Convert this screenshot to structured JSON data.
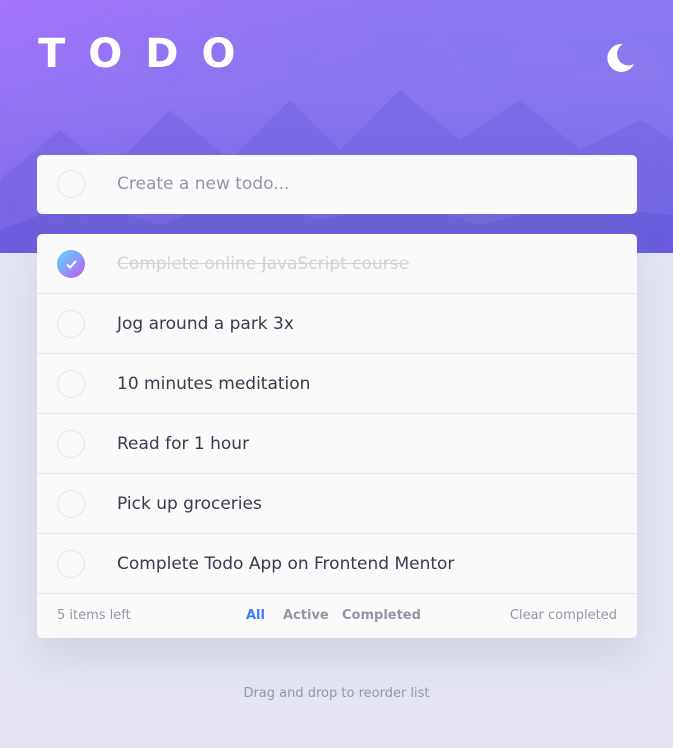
{
  "app": {
    "title": "TODO",
    "theme_toggle_icon": "moon-icon"
  },
  "new_todo": {
    "placeholder": "Create a new todo..."
  },
  "todos": [
    {
      "text": "Complete online JavaScript course",
      "completed": true
    },
    {
      "text": "Jog around a park 3x",
      "completed": false
    },
    {
      "text": "10 minutes meditation",
      "completed": false
    },
    {
      "text": "Read for 1 hour",
      "completed": false
    },
    {
      "text": "Pick up groceries",
      "completed": false
    },
    {
      "text": "Complete Todo App on Frontend Mentor",
      "completed": false
    }
  ],
  "footer": {
    "items_left": "5 items left",
    "filters": [
      {
        "label": "All",
        "active": true
      },
      {
        "label": "Active",
        "active": false
      },
      {
        "label": "Completed",
        "active": false
      }
    ],
    "clear_label": "Clear completed"
  },
  "hint": "Drag and drop to reorder list",
  "colors": {
    "accent": "#3a7cfd",
    "check_gradient_start": "#57ddff",
    "check_gradient_end": "#c058f3",
    "background": "#e4e5f1"
  }
}
